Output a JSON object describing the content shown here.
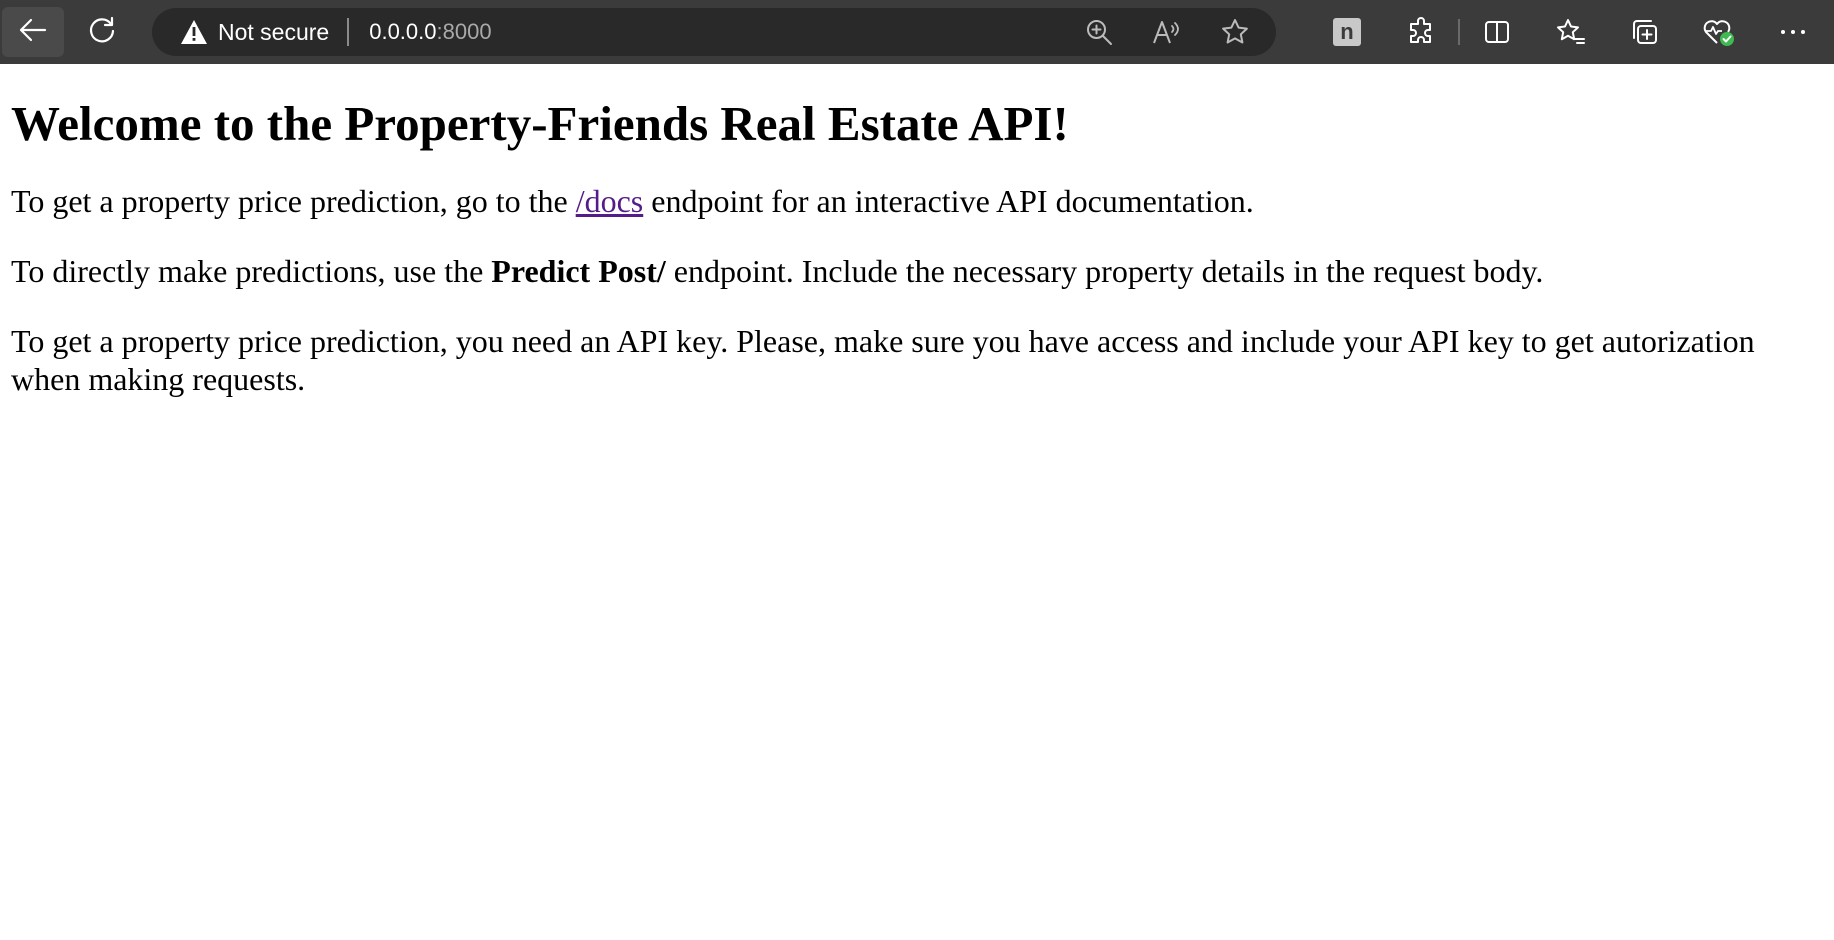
{
  "browser": {
    "security_label": "Not secure",
    "url_host": "0.0.0.0",
    "url_port": ":8000",
    "extension_label": "n",
    "icons": [
      "back-icon",
      "reload-icon",
      "warning-icon",
      "zoom-icon",
      "read-aloud-icon",
      "favorite-star-icon",
      "extension-n-icon",
      "extensions-puzzle-icon",
      "split-screen-icon",
      "favorites-icon",
      "collections-icon",
      "browser-essentials-icon",
      "more-icon"
    ]
  },
  "page": {
    "heading": "Welcome to the Property-Friends Real Estate API!",
    "p1_before": "To get a property price prediction, go to the ",
    "p1_link": "/docs",
    "p1_after": " endpoint for an interactive API documentation.",
    "p2_before": "To directly make predictions, use the ",
    "p2_bold": "Predict Post/",
    "p2_after": " endpoint. Include the necessary property details in the request body.",
    "p3": "To get a property price prediction, you need an API key. Please, make sure you have access and include your API key to get autorization when making requests."
  },
  "colors": {
    "toolbar": "#3b3b3b",
    "addressbar": "#292929",
    "link_visited": "#551a8b",
    "status_ok": "#3fb950"
  }
}
